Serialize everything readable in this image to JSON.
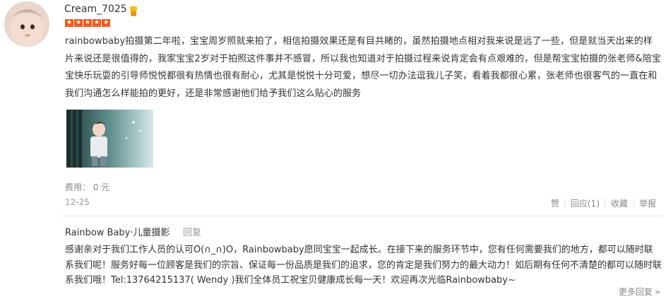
{
  "review": {
    "username": "Cream_7025",
    "vip_icon": "vip-badge-icon",
    "stars": 5,
    "star_color": "#f15a22",
    "text": "rainbowbaby拍摄第二年啦，宝宝周岁照就来拍了，相信拍摄效果还是有目共睹的，虽然拍摄地点相对我来说是远了一些，但是就当天出来的样片来说还是很值得的，我家宝宝2岁对于拍照这件事并不感冒，所以我也知道对于拍摄过程来说肯定会有点艰难的，但是帮宝宝拍摄的张老师&陪宝宝快乐玩耍的引导师悦悦都很有热情也很有耐心，尤其是悦悦十分可爱，想尽一切办法逗我儿子笑，看着我都很心累，张老师也很客气的一直在和我们沟通怎么样能拍的更好，还是非常感谢他们给予我们这么贴心的服务",
    "fee_label": "费用：",
    "fee_value": "0 元",
    "date": "12-25",
    "actions": {
      "like": "赞",
      "reply": "回应(1)",
      "favorite": "收藏",
      "report": "举报"
    }
  },
  "merchant_reply": {
    "name": "Rainbow Baby·儿童摄影",
    "reply_link": "回复",
    "text": "感谢亲对于我们工作人员的认可O(∩_∩)O，Rainbowbaby愿同宝宝一起成长。在接下来的服务环节中，您有任何需要我们的地方，都可以随时联系我们呢！服务好每一位顾客是我们的宗旨、保证每一份品质是我们的追求，您的肯定是我们努力的最大动力！如后期有任何不清楚的都可以随时联系我们哦！Tel:13764215137( Wendy )我们全体员工祝宝贝健康成长每一天！欢迎再次光临Rainbowbaby~",
    "more": "更多回复 »"
  }
}
